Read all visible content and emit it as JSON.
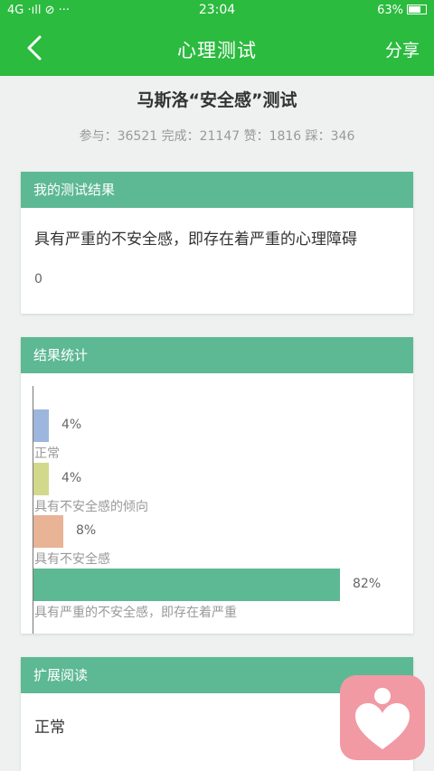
{
  "status_bar": {
    "left_text": "4G ·ıll ⊘ ···",
    "time": "23:04",
    "battery": "63%"
  },
  "nav": {
    "title": "心理测试",
    "share": "分享"
  },
  "test": {
    "title": "马斯洛“安全感”测试",
    "stats": "参与：36521 完成：21147 赞：1816 踩：346"
  },
  "my_result": {
    "header": "我的测试结果",
    "text": "具有严重的不安全感，即存在着严重的心理障碍",
    "score": "0"
  },
  "statistics": {
    "header": "结果统计"
  },
  "chart_data": {
    "type": "bar",
    "orientation": "horizontal",
    "categories": [
      "正常",
      "具有不安全感的倾向",
      "具有不安全感",
      "具有严重的不安全感，即存在着严重"
    ],
    "values": [
      4,
      4,
      8,
      82
    ],
    "value_labels": [
      "4%",
      "4%",
      "8%",
      "82%"
    ],
    "colors": [
      "#9db6dd",
      "#d2d98a",
      "#e9b396",
      "#5db894"
    ],
    "unit": "%"
  },
  "extended_reading": {
    "header": "扩展阅读",
    "text": "正常"
  },
  "colors": {
    "primary": "#2bbb3f",
    "card_header": "#5db894",
    "float_button": "#f19aa4"
  },
  "icons": [
    "back-arrow-icon",
    "heart-person-icon"
  ]
}
